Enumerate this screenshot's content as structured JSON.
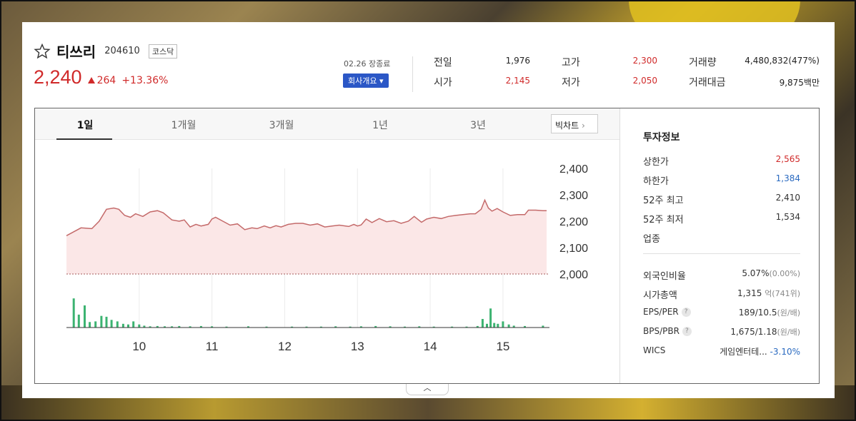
{
  "stock": {
    "name": "티쓰리",
    "code": "204610",
    "market": "코스닥",
    "price": "2,240",
    "change": "264",
    "change_pct": "+13.36%",
    "close_label": "02.26 장종료",
    "company_button": "회사개요"
  },
  "quotes": {
    "prev_close_label": "전일",
    "prev_close": "1,976",
    "open_label": "시가",
    "open": "2,145",
    "high_label": "고가",
    "high": "2,300",
    "low_label": "저가",
    "low": "2,050",
    "volume_label": "거래량",
    "volume": "4,480,832(477%)",
    "amount_label": "거래대금",
    "amount": "9,875백만"
  },
  "tabs": [
    "1일",
    "1개월",
    "3개월",
    "1년",
    "3년"
  ],
  "big_chart_label": "빅차트",
  "chart_data": {
    "type": "area",
    "ylim": [
      2000,
      2400
    ],
    "yticks": [
      "2,400",
      "2,300",
      "2,200",
      "2,100",
      "2,000"
    ],
    "ytick_values": [
      2400,
      2300,
      2200,
      2100,
      2000
    ],
    "xticks": [
      "10",
      "11",
      "12",
      "13",
      "14",
      "15"
    ],
    "x_hours": [
      10,
      11,
      12,
      13,
      14,
      15
    ],
    "x_range": [
      9.0,
      15.6
    ],
    "price": [
      [
        9.0,
        2145
      ],
      [
        9.1,
        2160
      ],
      [
        9.2,
        2175
      ],
      [
        9.35,
        2172
      ],
      [
        9.45,
        2200
      ],
      [
        9.55,
        2245
      ],
      [
        9.65,
        2250
      ],
      [
        9.72,
        2245
      ],
      [
        9.8,
        2222
      ],
      [
        9.88,
        2215
      ],
      [
        9.95,
        2228
      ],
      [
        10.05,
        2218
      ],
      [
        10.15,
        2235
      ],
      [
        10.25,
        2240
      ],
      [
        10.33,
        2232
      ],
      [
        10.45,
        2205
      ],
      [
        10.55,
        2200
      ],
      [
        10.62,
        2205
      ],
      [
        10.7,
        2178
      ],
      [
        10.78,
        2188
      ],
      [
        10.85,
        2182
      ],
      [
        10.95,
        2188
      ],
      [
        11.0,
        2208
      ],
      [
        11.05,
        2215
      ],
      [
        11.15,
        2200
      ],
      [
        11.25,
        2185
      ],
      [
        11.35,
        2190
      ],
      [
        11.45,
        2168
      ],
      [
        11.55,
        2175
      ],
      [
        11.62,
        2172
      ],
      [
        11.72,
        2182
      ],
      [
        11.8,
        2175
      ],
      [
        11.88,
        2183
      ],
      [
        11.95,
        2178
      ],
      [
        12.05,
        2188
      ],
      [
        12.15,
        2192
      ],
      [
        12.25,
        2192
      ],
      [
        12.35,
        2185
      ],
      [
        12.45,
        2190
      ],
      [
        12.55,
        2178
      ],
      [
        12.65,
        2182
      ],
      [
        12.75,
        2185
      ],
      [
        12.88,
        2180
      ],
      [
        12.95,
        2188
      ],
      [
        13.0,
        2182
      ],
      [
        13.05,
        2186
      ],
      [
        13.12,
        2208
      ],
      [
        13.2,
        2195
      ],
      [
        13.3,
        2210
      ],
      [
        13.4,
        2198
      ],
      [
        13.5,
        2202
      ],
      [
        13.6,
        2192
      ],
      [
        13.7,
        2200
      ],
      [
        13.78,
        2218
      ],
      [
        13.88,
        2196
      ],
      [
        13.95,
        2208
      ],
      [
        14.05,
        2215
      ],
      [
        14.15,
        2210
      ],
      [
        14.25,
        2218
      ],
      [
        14.35,
        2222
      ],
      [
        14.45,
        2225
      ],
      [
        14.55,
        2228
      ],
      [
        14.62,
        2228
      ],
      [
        14.7,
        2245
      ],
      [
        14.75,
        2280
      ],
      [
        14.8,
        2250
      ],
      [
        14.85,
        2238
      ],
      [
        14.92,
        2248
      ],
      [
        15.0,
        2235
      ],
      [
        15.1,
        2222
      ],
      [
        15.2,
        2225
      ],
      [
        15.3,
        2225
      ],
      [
        15.35,
        2242
      ],
      [
        15.45,
        2242
      ],
      [
        15.55,
        2240
      ],
      [
        15.6,
        2240
      ]
    ],
    "volume_rel": [
      [
        9.1,
        0.95
      ],
      [
        9.17,
        0.42
      ],
      [
        9.25,
        0.72
      ],
      [
        9.32,
        0.18
      ],
      [
        9.4,
        0.2
      ],
      [
        9.48,
        0.38
      ],
      [
        9.55,
        0.35
      ],
      [
        9.62,
        0.25
      ],
      [
        9.7,
        0.2
      ],
      [
        9.78,
        0.12
      ],
      [
        9.85,
        0.1
      ],
      [
        9.92,
        0.2
      ],
      [
        10.0,
        0.1
      ],
      [
        10.07,
        0.06
      ],
      [
        10.15,
        0.04
      ],
      [
        10.25,
        0.05
      ],
      [
        10.35,
        0.04
      ],
      [
        10.45,
        0.04
      ],
      [
        10.55,
        0.05
      ],
      [
        10.7,
        0.04
      ],
      [
        10.85,
        0.05
      ],
      [
        11.0,
        0.04
      ],
      [
        11.2,
        0.03
      ],
      [
        11.5,
        0.04
      ],
      [
        11.75,
        0.03
      ],
      [
        12.1,
        0.03
      ],
      [
        12.3,
        0.03
      ],
      [
        12.5,
        0.03
      ],
      [
        12.7,
        0.04
      ],
      [
        12.9,
        0.03
      ],
      [
        13.05,
        0.04
      ],
      [
        13.25,
        0.05
      ],
      [
        13.45,
        0.04
      ],
      [
        13.65,
        0.03
      ],
      [
        13.85,
        0.04
      ],
      [
        14.05,
        0.03
      ],
      [
        14.3,
        0.03
      ],
      [
        14.5,
        0.03
      ],
      [
        14.65,
        0.05
      ],
      [
        14.72,
        0.28
      ],
      [
        14.78,
        0.12
      ],
      [
        14.83,
        0.62
      ],
      [
        14.88,
        0.15
      ],
      [
        14.93,
        0.12
      ],
      [
        15.0,
        0.2
      ],
      [
        15.08,
        0.1
      ],
      [
        15.15,
        0.06
      ],
      [
        15.3,
        0.05
      ],
      [
        15.55,
        0.06
      ]
    ]
  },
  "invest": {
    "title": "투자정보",
    "rows1": [
      {
        "label": "상한가",
        "value": "2,565"
      },
      {
        "label": "하한가",
        "value": "1,384"
      },
      {
        "label": "52주 최고",
        "value": "2,410"
      },
      {
        "label": "52주 최저",
        "value": "1,534"
      },
      {
        "label": "업종",
        "value": ""
      }
    ],
    "foreign_label": "외국인비율",
    "foreign_value": "5.07%",
    "foreign_sub": "(0.00%)",
    "cap_label": "시가총액",
    "cap_value": "1,315",
    "cap_unit": "억",
    "cap_sub": "(741위)",
    "eps_label": "EPS/PER",
    "eps_value": "189/10.5",
    "eps_unit": "(원/배)",
    "bps_label": "BPS/PBR",
    "bps_value": "1,675/1.18",
    "bps_unit": "(원/배)",
    "wics_label": "WICS",
    "wics_value": "게임엔터테...",
    "wics_pct": "-3.10%"
  },
  "colors": {
    "up": "#d02a2a",
    "down": "#2a6ac0",
    "line": "#c46a6a",
    "fill": "#fbe7e7",
    "volume": "#3cb371"
  }
}
